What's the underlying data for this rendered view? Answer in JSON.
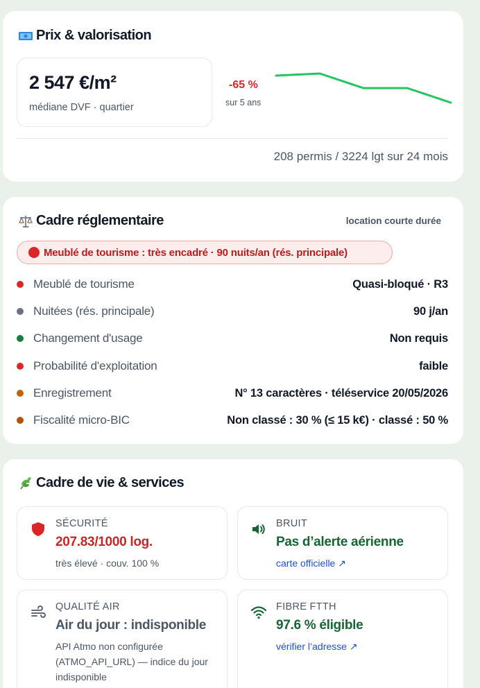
{
  "price": {
    "title": "Prix & valorisation",
    "value": "2 547 €/m²",
    "sub": "médiane DVF · quartier",
    "trend_pct": "-65 %",
    "trend_sub": "sur 5 ans",
    "permits": "208 permis / 3224 lgt sur 24 mois",
    "sparkline_values": [
      100,
      105,
      70,
      70,
      35
    ],
    "sparkline_color": "#22c55e"
  },
  "reg": {
    "title": "Cadre réglementaire",
    "tag": "location courte durée",
    "alert": "Meublé de tourisme : très encadré · 90 nuits/an (rés. principale)",
    "rows": [
      {
        "label": "Meublé de tourisme",
        "value": "Quasi-bloqué · R3",
        "color": "#dc2626"
      },
      {
        "label": "Nuitées (rés. principale)",
        "value": "90 j/an",
        "color": "#6b7280"
      },
      {
        "label": "Changement d'usage",
        "value": "Non requis",
        "color": "#15803d"
      },
      {
        "label": "Probabilité d'exploitation",
        "value": "faible",
        "color": "#dc2626"
      },
      {
        "label": "Enregistrement",
        "value": "N° 13 caractères · téléservice 20/05/2026",
        "color": "#c2620e"
      },
      {
        "label": "Fiscalité micro-BIC",
        "value": "Non classé : 30 % (≤ 15 k€) · classé : 50 %",
        "color": "#b45309"
      }
    ]
  },
  "life": {
    "title": "Cadre de vie & services",
    "security": {
      "cat": "SÉCURITÉ",
      "value": "207.83/1000 log.",
      "sub": "très élevé · couv. 100 %",
      "color": "#c62828"
    },
    "noise": {
      "cat": "BRUIT",
      "value": "Pas d’alerte aérienne",
      "link": "carte officielle ↗",
      "color": "#166534"
    },
    "air": {
      "cat": "QUALITÉ AIR",
      "value": "Air du jour : indisponible",
      "sub": "API Atmo non configurée (ATMO_API_URL) — indice du jour indisponible",
      "color": "#4b5563"
    },
    "fibre": {
      "cat": "FIBRE FTTH",
      "value": "97.6 % éligible",
      "link": "vérifier l’adresse ↗",
      "color": "#166534"
    }
  }
}
